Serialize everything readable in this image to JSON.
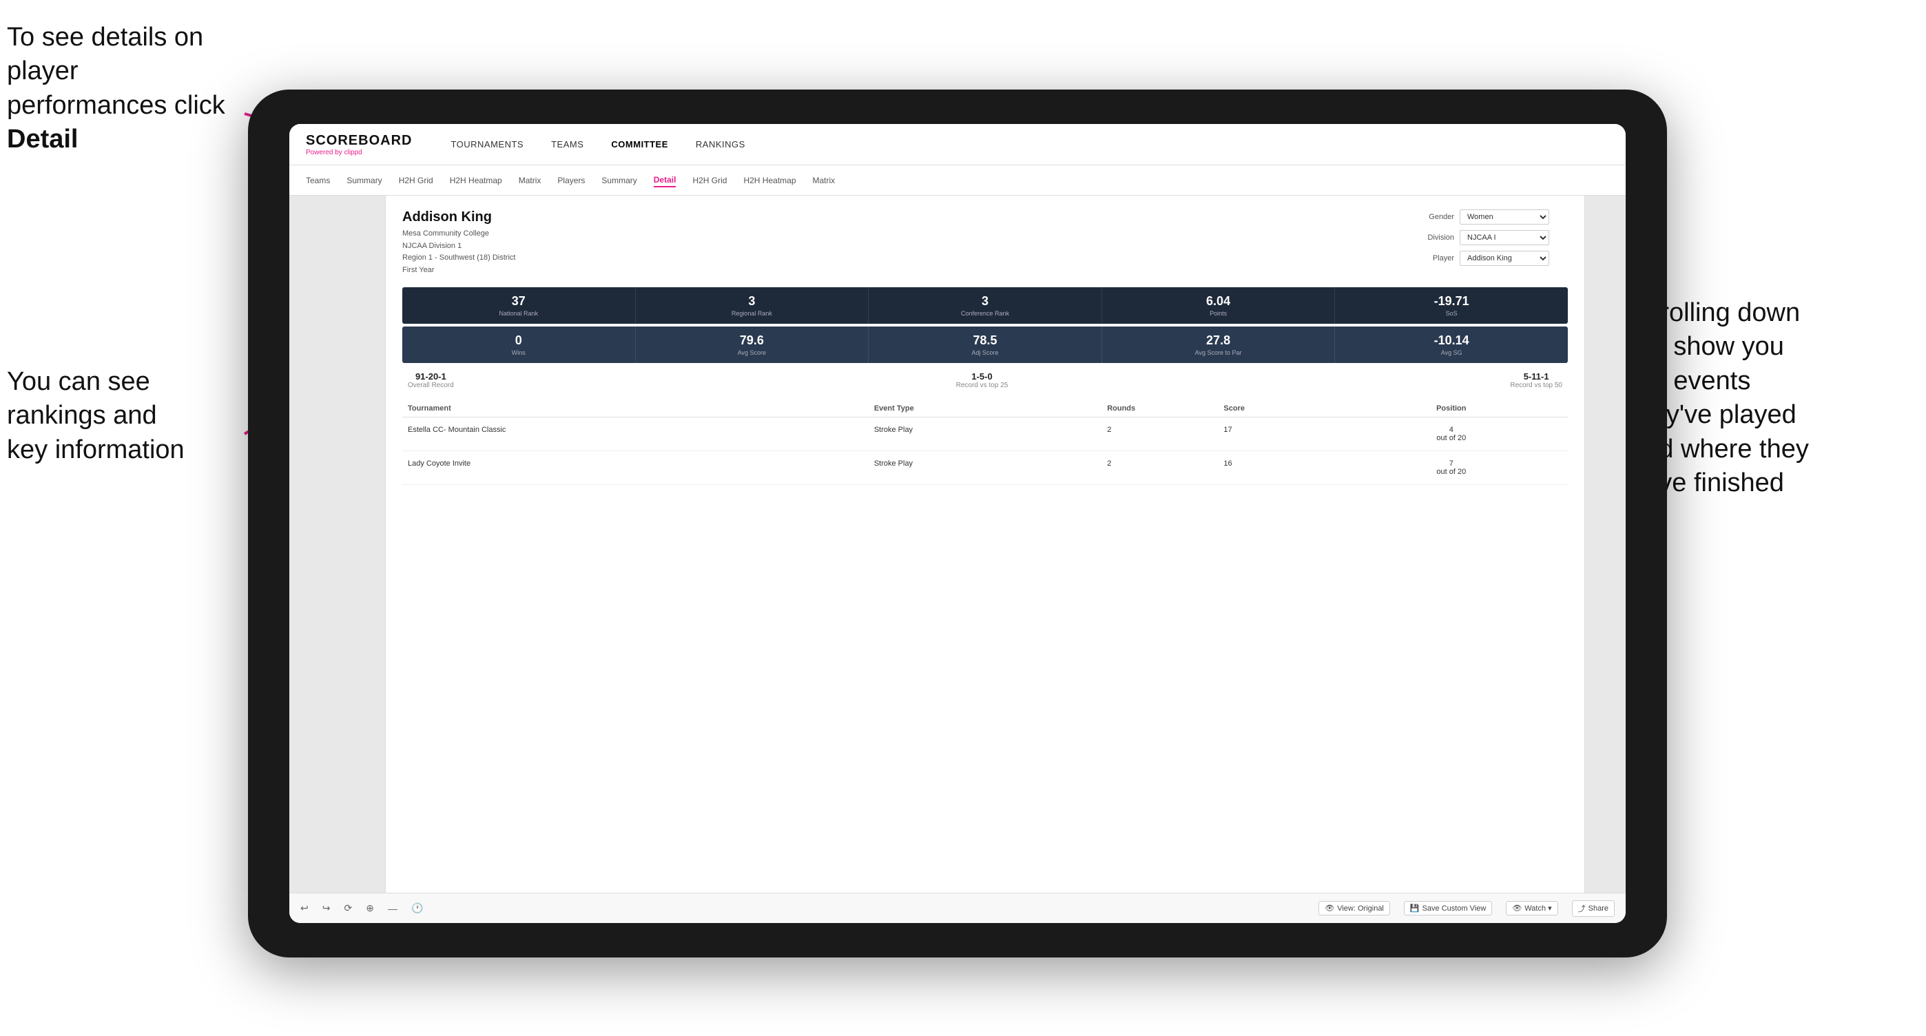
{
  "annotations": {
    "topleft": "To see details on player performances click ",
    "topleft_bold": "Detail",
    "bottomleft_line1": "You can see",
    "bottomleft_line2": "rankings and",
    "bottomleft_line3": "key information",
    "bottomright_line1": "Scrolling down",
    "bottomright_line2": "will show you",
    "bottomright_line3": "the events",
    "bottomright_line4": "they've played",
    "bottomright_line5": "and where they",
    "bottomright_line6": "have finished"
  },
  "nav": {
    "logo": "SCOREBOARD",
    "logo_powered": "Powered by ",
    "logo_brand": "clippd",
    "items": [
      "TOURNAMENTS",
      "TEAMS",
      "COMMITTEE",
      "RANKINGS"
    ]
  },
  "subnav": {
    "items": [
      "Teams",
      "Summary",
      "H2H Grid",
      "H2H Heatmap",
      "Matrix",
      "Players",
      "Summary",
      "Detail",
      "H2H Grid",
      "H2H Heatmap",
      "Matrix"
    ],
    "active": "Detail"
  },
  "player": {
    "name": "Addison King",
    "school": "Mesa Community College",
    "division": "NJCAA Division 1",
    "region": "Region 1 - Southwest (18) District",
    "year": "First Year"
  },
  "selectors": {
    "gender_label": "Gender",
    "gender_value": "Women",
    "division_label": "Division",
    "division_value": "NJCAA I",
    "player_label": "Player",
    "player_value": "Addison King"
  },
  "stats1": [
    {
      "value": "37",
      "label": "National Rank"
    },
    {
      "value": "3",
      "label": "Regional Rank"
    },
    {
      "value": "3",
      "label": "Conference Rank"
    },
    {
      "value": "6.04",
      "label": "Points"
    },
    {
      "value": "-19.71",
      "label": "SoS"
    }
  ],
  "stats2": [
    {
      "value": "0",
      "label": "Wins"
    },
    {
      "value": "79.6",
      "label": "Avg Score"
    },
    {
      "value": "78.5",
      "label": "Adj Score"
    },
    {
      "value": "27.8",
      "label": "Avg Score to Par"
    },
    {
      "value": "-10.14",
      "label": "Avg SG"
    }
  ],
  "records": [
    {
      "value": "91-20-1",
      "label": "Overall Record"
    },
    {
      "value": "1-5-0",
      "label": "Record vs top 25"
    },
    {
      "value": "5-11-1",
      "label": "Record vs top 50"
    }
  ],
  "table": {
    "headers": [
      "Tournament",
      "Event Type",
      "Rounds",
      "Score",
      "Position"
    ],
    "rows": [
      {
        "tournament": "Estella CC- Mountain Classic",
        "event_type": "Stroke Play",
        "rounds": "2",
        "score": "17",
        "position": "4\nout of 20"
      },
      {
        "tournament": "Lady Coyote Invite",
        "event_type": "Stroke Play",
        "rounds": "2",
        "score": "16",
        "position": "7\nout of 20"
      }
    ]
  },
  "toolbar": {
    "view_label": "View: Original",
    "save_label": "Save Custom View",
    "watch_label": "Watch ▾",
    "share_label": "Share"
  }
}
